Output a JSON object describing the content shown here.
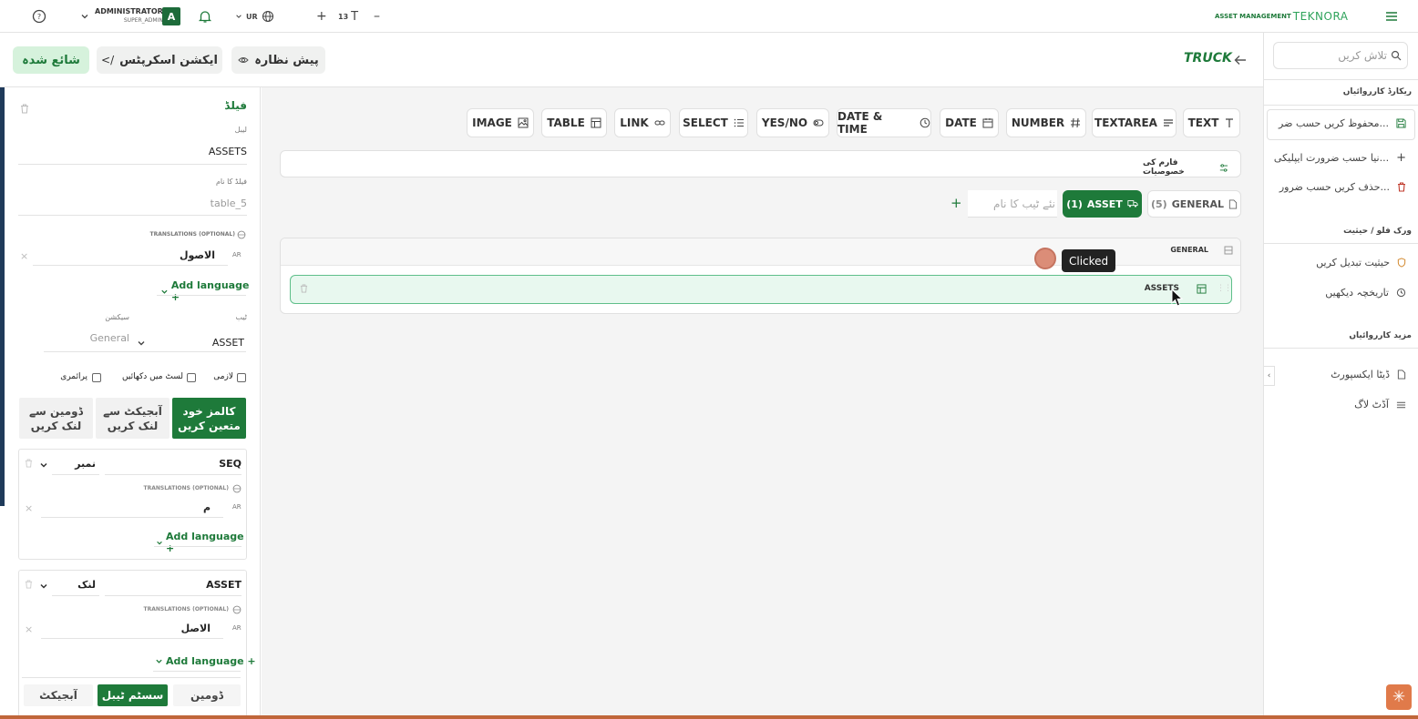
{
  "topbar": {
    "help_icon": "help-circle-icon",
    "user_role": "ADMINISTRATOR",
    "user_sub": "SUPER_ADMIN",
    "avatar_letter": "A",
    "lang_code": "UR",
    "font_size": "13",
    "brand_small": "ASSET MANAGEMENT",
    "brand_logo": "TEKNORA"
  },
  "header": {
    "page_title": "TRUCK",
    "publish_label": "شائع شدہ",
    "action_scripts_label": "ایکشن اسکرپٹس",
    "preview_label": "پیش نظارہ"
  },
  "field_types": [
    {
      "label": "TEXT",
      "icon": "text-icon"
    },
    {
      "label": "TEXTAREA",
      "icon": "textarea-icon"
    },
    {
      "label": "NUMBER",
      "icon": "hash-icon"
    },
    {
      "label": "DATE",
      "icon": "calendar-icon"
    },
    {
      "label": "DATE & TIME",
      "icon": "clock-icon"
    },
    {
      "label": "YES/NO",
      "icon": "toggle-icon"
    },
    {
      "label": "SELECT",
      "icon": "list-icon"
    },
    {
      "label": "LINK",
      "icon": "link-icon"
    },
    {
      "label": "TABLE",
      "icon": "table-icon"
    },
    {
      "label": "IMAGE",
      "icon": "image-icon"
    }
  ],
  "form_props_label": "فارم کی خصوصیات",
  "tabs": {
    "general_label": "GENERAL",
    "general_count": "(5)",
    "asset_label": "ASSET",
    "asset_count": "(1)",
    "new_tab_placeholder": "نئے ٹیب کا نام",
    "add_symbol": "+"
  },
  "section": {
    "title": "GENERAL",
    "field_label": "ASSETS",
    "tooltip": "Clicked"
  },
  "field_panel": {
    "heading": "فیلڈ",
    "label_caption": "لیبل",
    "label_value": "ASSETS",
    "name_caption": "فیلڈ کا نام",
    "name_value": "table_5",
    "translations_caption": "TRANSLATIONS (OPTIONAL)",
    "lang_ar": "AR",
    "translation_value": "الاصول",
    "add_language": "Add language +",
    "tab_caption": "ٹیب",
    "tab_value": "ASSET",
    "section_caption": "سیکشن",
    "section_value": "General",
    "checkbox_required": "لازمی",
    "checkbox_show_in_list": "لسٹ میں دکھائیں",
    "checkbox_readonly": "پرائمری",
    "mode_manual": "کالمز خود متعین کریں",
    "mode_object": "آبجیکٹ سے لنک کریں",
    "mode_domain": "ڈومین سے لنک کریں",
    "col1_name": "SEQ",
    "col1_type": "نمبر",
    "col1_translation": "م",
    "col2_name": "ASSET",
    "col2_type": "لنک",
    "col2_translation": "الاصل",
    "link_domain": "ڈومین",
    "link_system_table": "سسٹم ٹیبل",
    "link_object": "آبجیکٹ"
  },
  "right_sidebar": {
    "search_placeholder": "تلاش کریں",
    "records_heading": "ریکارڈ کارروائیاں",
    "save_custom": "محفوظ کریں حسب ضر...",
    "new_custom": "نیا حسب ضرورت ایپلیکی...",
    "delete_custom": "حذف کریں حسب ضرور...",
    "workflow_heading": "ورک فلو / حیثیت",
    "change_status": "حیثیت تبدیل کریں",
    "view_history": "تاریخچہ دیکھیں",
    "more_heading": "مزید کارروائیاں",
    "data_export": "ڈیٹا ایکسپورٹ",
    "audit_log": "آڈٹ لاگ"
  },
  "colors": {
    "brand_green": "#1e7a3a",
    "selected_field_bg": "#e8f8ef",
    "selected_field_border": "#5fbf8a",
    "click_marker": "#d9826b"
  }
}
